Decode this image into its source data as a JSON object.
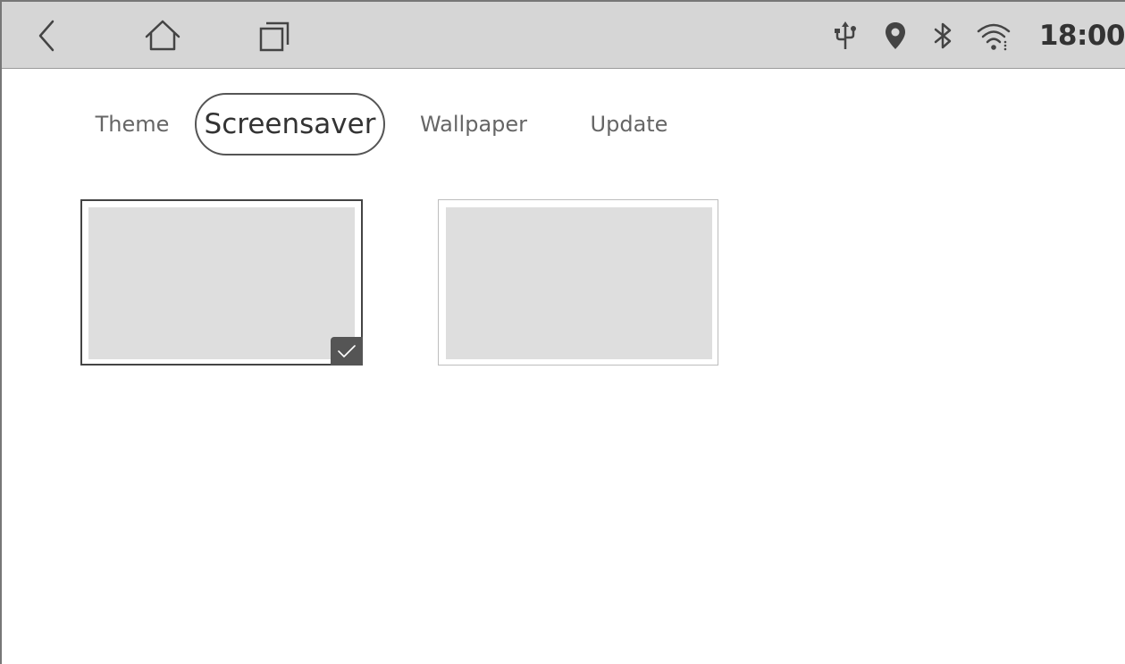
{
  "statusbar": {
    "nav": {
      "back_icon": "chevron-left-icon",
      "home_icon": "home-icon",
      "recents_icon": "recent-apps-icon"
    },
    "icons": [
      "usb-icon",
      "location-pin-icon",
      "bluetooth-icon",
      "wifi-icon"
    ],
    "time": "18:00"
  },
  "tabs": [
    {
      "label": "Theme",
      "active": false
    },
    {
      "label": "Screensaver",
      "active": true
    },
    {
      "label": "Wallpaper",
      "active": false
    },
    {
      "label": "Update",
      "active": false
    }
  ],
  "screensavers": [
    {
      "selected": true,
      "check_icon": "checkmark-icon"
    },
    {
      "selected": false
    }
  ],
  "colors": {
    "statusbar_bg": "#d6d6d6",
    "text_dark": "#333333",
    "text_muted": "#666666",
    "preview_fill": "#dedede",
    "badge_bg": "#555555"
  }
}
